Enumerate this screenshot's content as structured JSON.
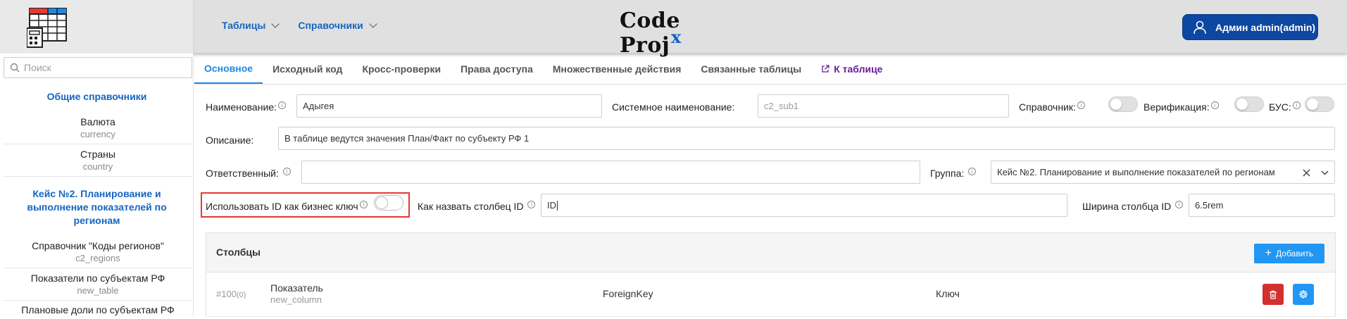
{
  "header": {
    "nav": [
      {
        "label": "Таблицы"
      },
      {
        "label": "Справочники"
      }
    ],
    "brand": {
      "main": "Code Proj",
      "sub": "x"
    },
    "user_label": "Админ admin(admin)",
    "colors": {
      "header_bg": "#e0e0e0",
      "user_btn": "#0d47a1",
      "accent": "#1565c0"
    }
  },
  "sidebar": {
    "search_placeholder": "Поиск",
    "sections": [
      {
        "title": "Общие справочники",
        "items": [
          {
            "title": "Валюта",
            "sub": "currency"
          },
          {
            "title": "Страны",
            "sub": "country"
          }
        ]
      },
      {
        "title": "Кейс №2. Планирование и выполнение показателей по регионам",
        "items": [
          {
            "title": "Справочник \"Коды регионов\"",
            "sub": "c2_regions"
          },
          {
            "title": "Показатели по субъектам РФ",
            "sub": "new_table"
          },
          {
            "title": "Плановые доли по субъектам РФ",
            "sub": ""
          }
        ]
      }
    ]
  },
  "tabs": [
    {
      "label": "Основное",
      "active": true
    },
    {
      "label": "Исходный код"
    },
    {
      "label": "Кросс-проверки"
    },
    {
      "label": "Права доступа"
    },
    {
      "label": "Множественные действия"
    },
    {
      "label": "Связанные таблицы"
    },
    {
      "label": "К таблице",
      "link": true
    }
  ],
  "form": {
    "name_label": "Наименование:",
    "name_value": "Адыгея",
    "sysname_label": "Системное наименование:",
    "sysname_placeholder": "c2_sub1",
    "directory_label": "Справочник:",
    "verification_label": "Верификация:",
    "bus_label": "БУС:",
    "description_label": "Описание:",
    "description_value": "В таблице ведутся значения План/Факт по субъекту РФ 1",
    "responsible_label": "Ответственный:",
    "responsible_value": "",
    "group_label": "Группа:",
    "group_value": "Кейс №2. Планирование и выполнение показателей по регионам",
    "use_id_label": "Использовать ID как бизнес ключ",
    "id_col_name_label": "Как назвать столбец ID",
    "id_col_name_value": "ID",
    "id_col_width_label": "Ширина столбца ID",
    "id_col_width_value": "6.5rem"
  },
  "columns_panel": {
    "title": "Столбцы",
    "add_label": "Добавить",
    "rows": [
      {
        "id": "#100",
        "order": "(0)",
        "name": "Показатель",
        "sysname": "new_column",
        "type": "ForeignKey",
        "key": "Ключ"
      }
    ]
  }
}
